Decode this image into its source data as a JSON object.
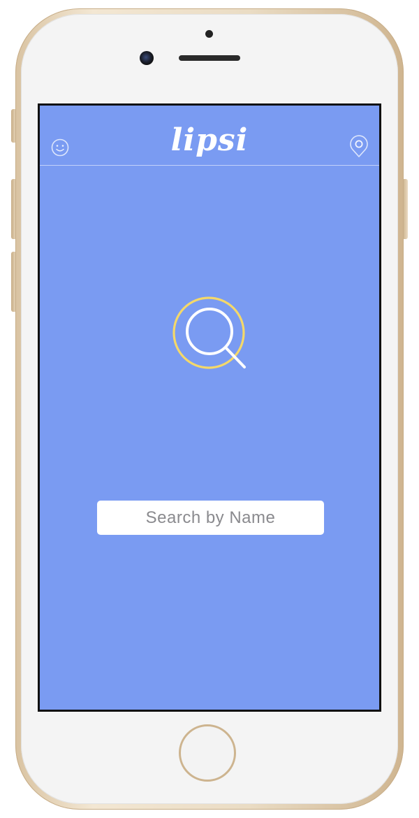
{
  "app": {
    "brand": "lipsi",
    "accent_color": "#7a9bf2",
    "highlight_color": "#f4d86a"
  },
  "nav": {
    "left_icon": "smiley-face-icon",
    "right_icon": "location-pin-icon"
  },
  "hero": {
    "icon": "magnifying-glass-icon"
  },
  "search": {
    "value": "",
    "placeholder": "Search by Name"
  },
  "device": {
    "model": "iPhone",
    "home_button_icon": "home-button"
  }
}
